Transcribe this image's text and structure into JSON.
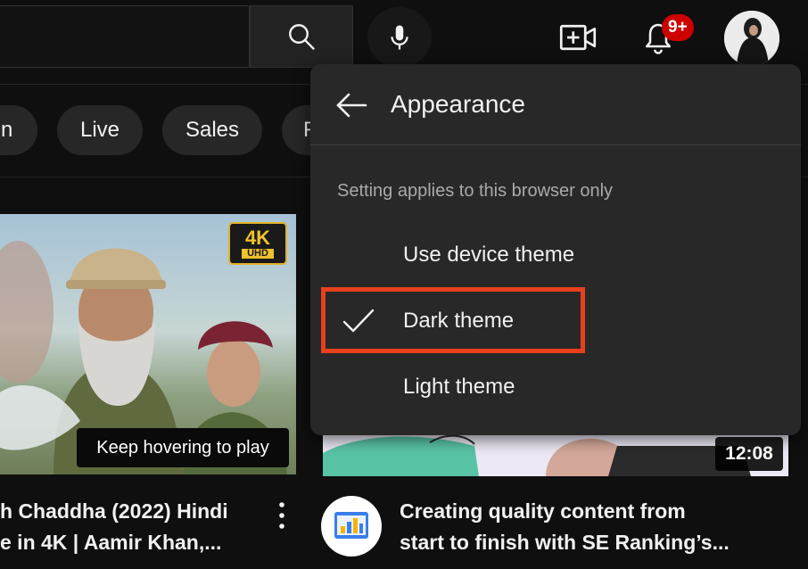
{
  "colors": {
    "accent_red": "#cc0000",
    "highlight": "#e8401c",
    "menu_bg": "#282828",
    "page_bg": "#0f0f0f"
  },
  "header": {
    "search_icon": "search-icon",
    "mic_icon": "microphone-icon",
    "create_icon": "video-camera-plus-icon",
    "notifications_icon": "bell-icon",
    "notifications_badge": "9+"
  },
  "chips": [
    "gn",
    "Live",
    "Sales",
    "F"
  ],
  "videos": [
    {
      "badge": {
        "top": "4K",
        "bottom": "UHD"
      },
      "hover_tip": "Keep hovering to play",
      "title_line1": "h Chaddha (2022) Hindi",
      "title_line2": "e in 4K | Aamir Khan,..."
    },
    {
      "duration": "12:08",
      "title_line1": "Creating quality content from",
      "title_line2": "start to finish with SE Ranking’s..."
    }
  ],
  "menu": {
    "title": "Appearance",
    "note": "Setting applies to this browser only",
    "options": [
      "Use device theme",
      "Dark theme",
      "Light theme"
    ],
    "selected_index": 1
  }
}
